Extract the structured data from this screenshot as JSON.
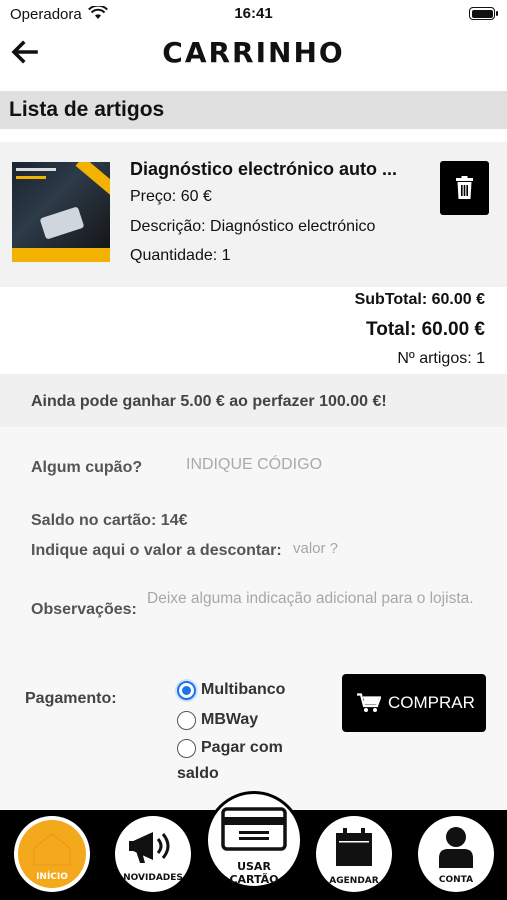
{
  "status_bar": {
    "carrier": "Operadora",
    "time": "16:41"
  },
  "nav": {
    "title": "CARRINHO",
    "back_icon": "arrow-left-icon"
  },
  "section": {
    "title": "Lista de artigos"
  },
  "cart_item": {
    "name": "Diagnóstico electrónico auto ...",
    "price": "Preço: 60 €",
    "description": "Descrição: Diagnóstico electrónico",
    "quantity": "Quantidade: 1",
    "delete_icon": "trash-icon"
  },
  "totals": {
    "subtotal": "SubTotal: 60.00 €",
    "total": "Total: 60.00 €",
    "count": "Nº artigos: 1"
  },
  "promo": {
    "text": "Ainda pode ganhar 5.00 € ao perfazer 100.00 €!"
  },
  "form": {
    "coupon_label": "Algum cupão?",
    "coupon_placeholder": "INDIQUE CÓDIGO",
    "balance": "Saldo no cartão: 14€",
    "discount_label": "Indique aqui o valor a descontar:",
    "discount_placeholder": "valor ?",
    "notes_label": "Observações:",
    "notes_placeholder": "Deixe alguma indicação adicional para o lojista.",
    "payment_label": "Pagamento:",
    "payment_options": [
      {
        "label": "Multibanco",
        "selected": true
      },
      {
        "label": "MBWay",
        "selected": false
      },
      {
        "label_line1": "Pagar com",
        "label_line2": "saldo",
        "selected": false
      }
    ],
    "buy_label": "COMPRAR",
    "buy_icon": "cart-icon"
  },
  "tabbar": {
    "inicio": "INÍCIO",
    "novidades": "NOVIDADES",
    "cartao_line1": "USAR",
    "cartao_line2": "CARTÃO",
    "agendar": "AGENDAR",
    "conta": "CONTA"
  },
  "colors": {
    "accent": "#f4a81c",
    "radio": "#1a73e8",
    "button": "#000000"
  }
}
